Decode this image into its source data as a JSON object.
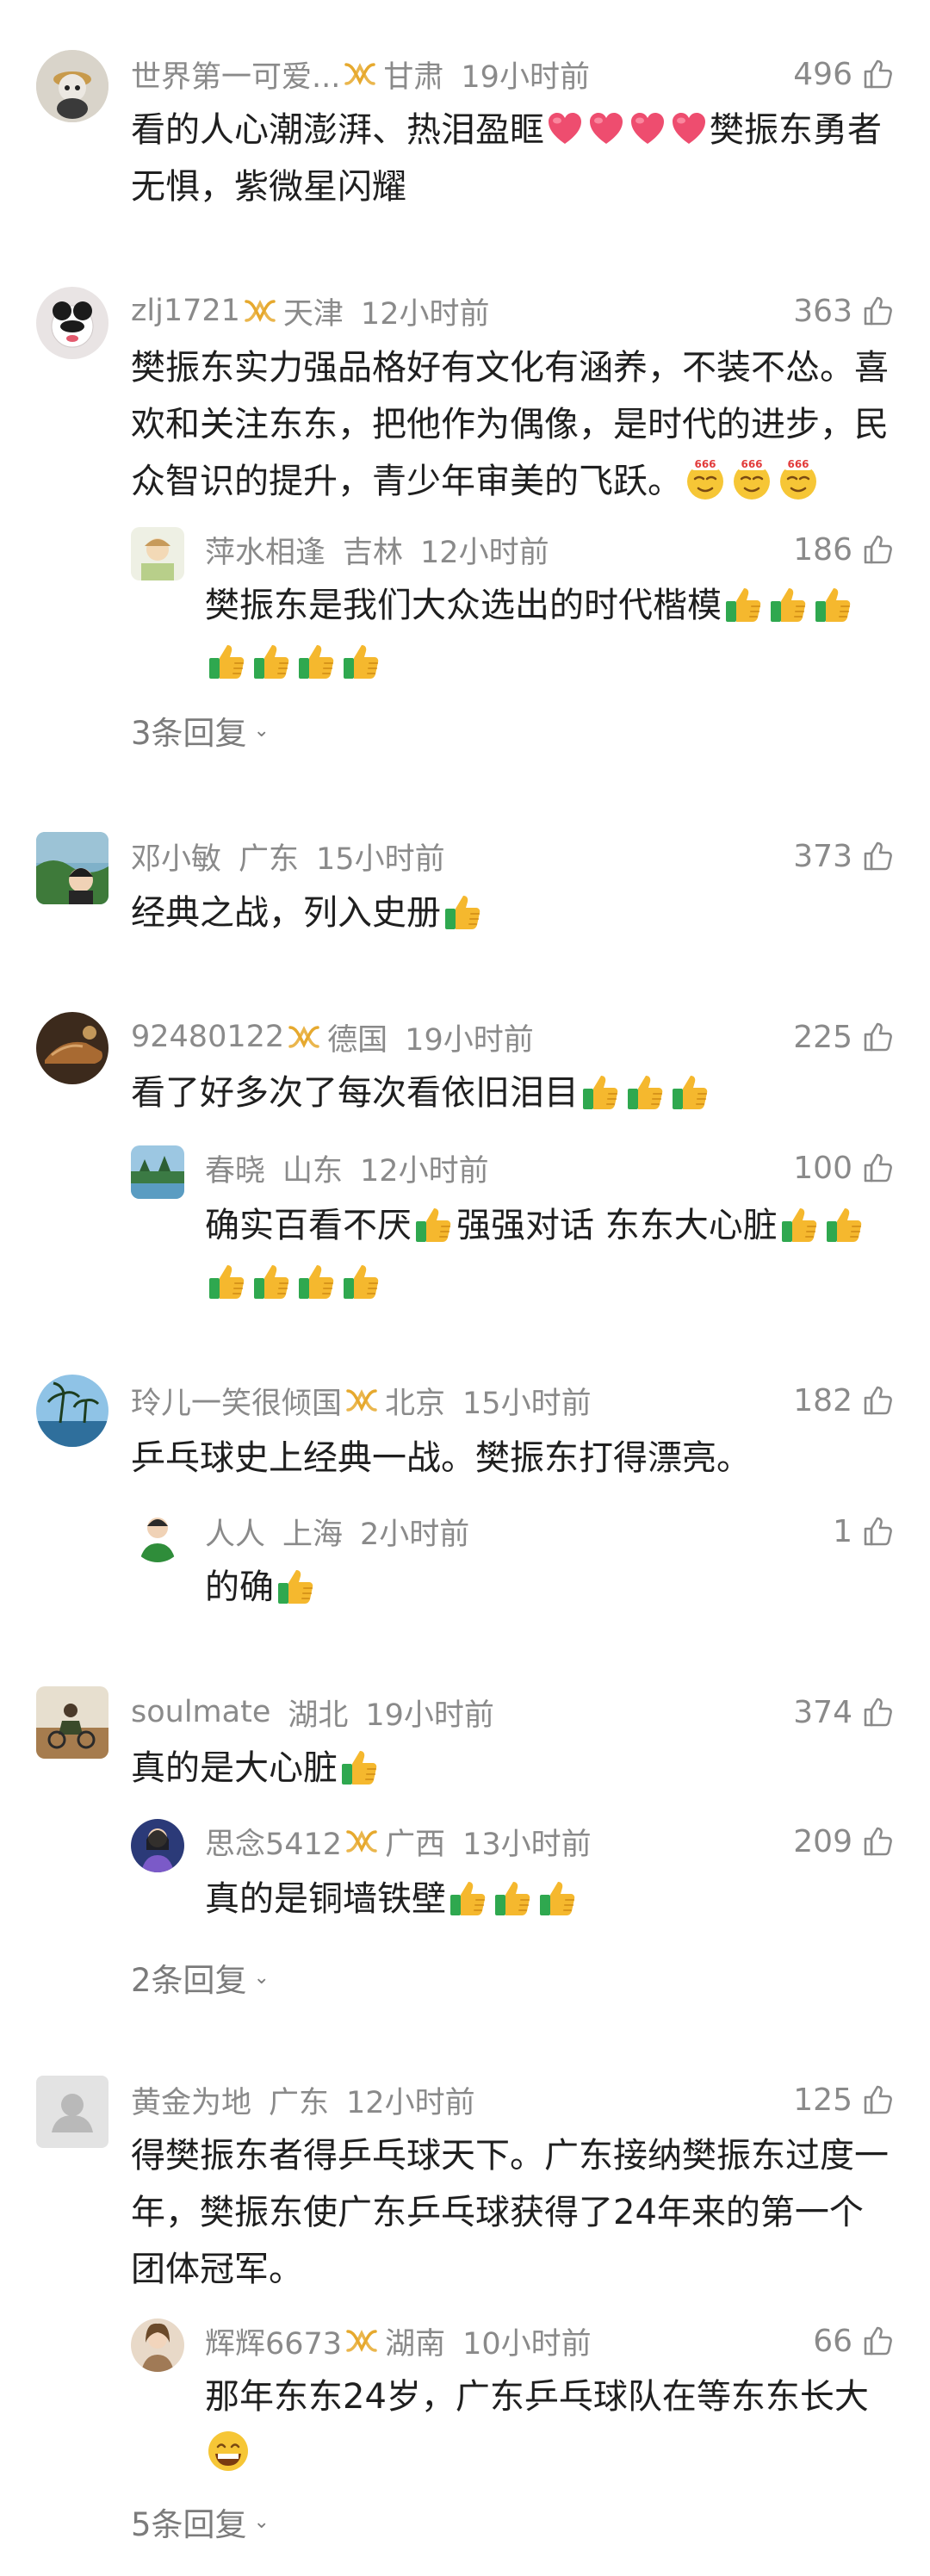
{
  "colors": {
    "meta": "#8a8a8a",
    "text": "#1f1f1f",
    "accent": "#f2b134"
  },
  "comments": [
    {
      "user": "世界第一可爱...",
      "badge": true,
      "location": "甘肃",
      "time": "19小时前",
      "likes": "496",
      "text_a": "看的人心潮澎湃、热泪盈眶",
      "text_b": "樊振东勇者无惧，紫微星闪耀",
      "emojis": [
        "heart-emoji",
        "heart-emoji",
        "heart-emoji",
        "heart-emoji"
      ]
    },
    {
      "user": "zlj1721",
      "badge": true,
      "location": "天津",
      "time": "12小时前",
      "likes": "363",
      "line1": "樊振东实力强品格好有文化有涵养，不装不怂。喜",
      "line2": "欢和关注东东，把他作为偶像，是时代的进步，民",
      "line3": "众智识的提升，青少年审美的飞跃。",
      "reply": {
        "user": "萍水相逢",
        "location": "吉林",
        "time": "12小时前",
        "likes": "186",
        "text": "樊振东是我们大众选出的时代楷模"
      },
      "more_replies": "3条回复"
    },
    {
      "user": "邓小敏",
      "badge": false,
      "location": "广东",
      "time": "15小时前",
      "likes": "373",
      "text": "经典之战，列入史册"
    },
    {
      "user": "92480122",
      "badge": true,
      "location": "德国",
      "time": "19小时前",
      "likes": "225",
      "text": "看了好多次了每次看依旧泪目",
      "reply": {
        "user": "春晓",
        "location": "山东",
        "time": "12小时前",
        "likes": "100",
        "text_a": "确实百看不厌",
        "text_b": "强强对话 东东大心脏"
      }
    },
    {
      "user": "玲儿一笑很倾国",
      "badge": true,
      "location": "北京",
      "time": "15小时前",
      "likes": "182",
      "text": "乒乓球史上经典一战。樊振东打得漂亮。",
      "reply": {
        "user": "人人",
        "location": "上海",
        "time": "2小时前",
        "likes": "1",
        "text": "的确"
      }
    },
    {
      "user": "soulmate",
      "badge": false,
      "location": "湖北",
      "time": "19小时前",
      "likes": "374",
      "text": "真的是大心脏",
      "reply": {
        "user": "思念5412",
        "badge": true,
        "location": "广西",
        "time": "13小时前",
        "likes": "209",
        "text": "真的是铜墙铁壁"
      },
      "more_replies": "2条回复"
    },
    {
      "user": "黄金为地",
      "badge": false,
      "location": "广东",
      "time": "12小时前",
      "likes": "125",
      "line1": "得樊振东者得乒乓球天下。广东接纳樊振东过度一",
      "line2": "年，樊振东使广东乒乓球获得了24年来的第一个",
      "line3": "团体冠军。",
      "reply": {
        "user": "辉辉6673",
        "badge": true,
        "location": "湖南",
        "time": "10小时前",
        "likes": "66",
        "text": "那年东东24岁，广东乒乓球队在等东东长大"
      },
      "more_replies": "5条回复"
    }
  ]
}
